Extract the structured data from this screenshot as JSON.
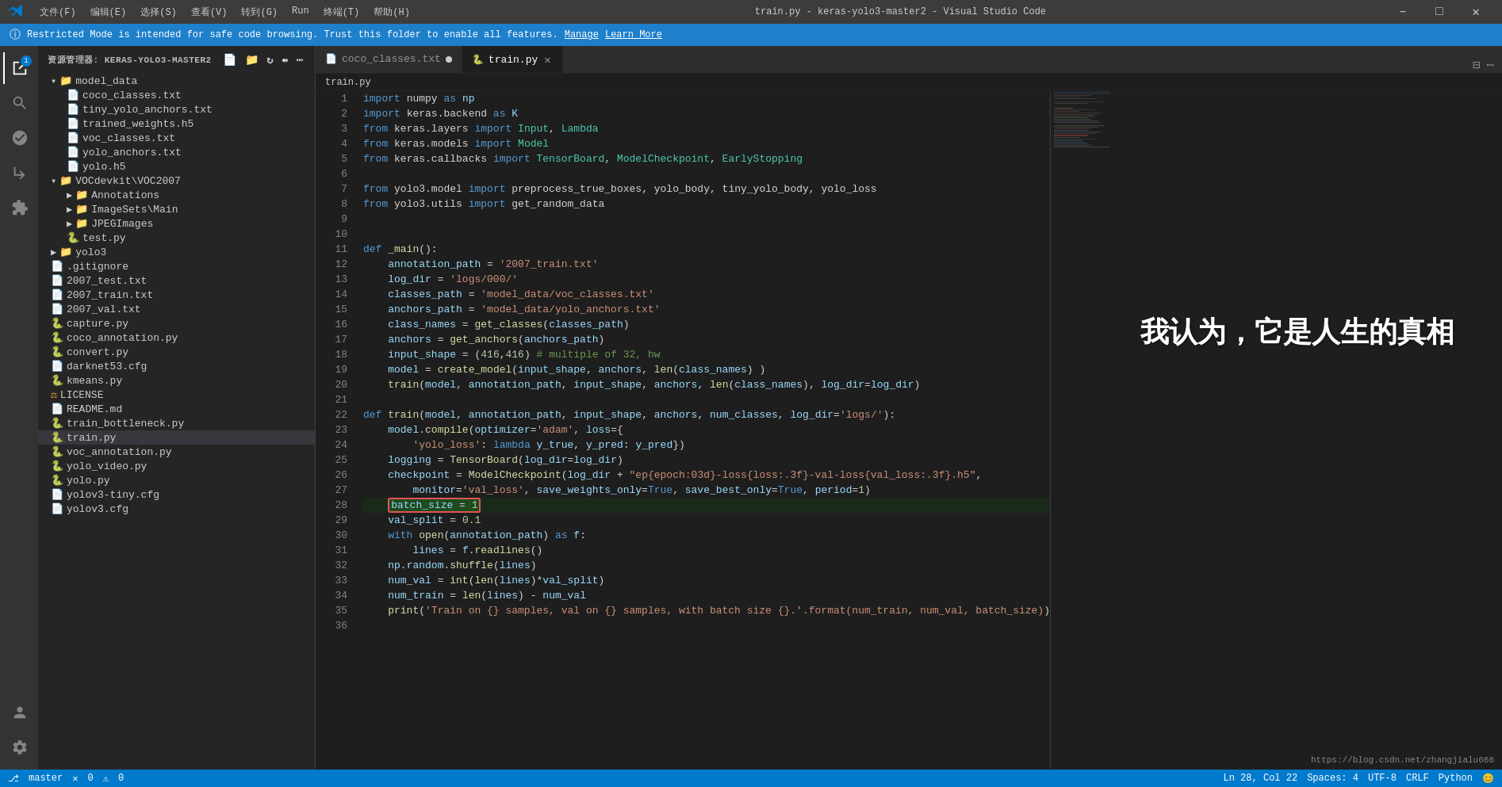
{
  "titlebar": {
    "menus": [
      "文件(F)",
      "编辑(E)",
      "选择(S)",
      "查看(V)",
      "转到(G)",
      "Run",
      "终端(T)",
      "帮助(H)"
    ],
    "title": "train.py - keras-yolo3-master2 - Visual Studio Code",
    "vscode_icon": "VS"
  },
  "notification": {
    "text": "Restricted Mode is intended for safe code browsing. Trust this folder to enable all features.",
    "manage": "Manage",
    "learn_more": "Learn More"
  },
  "sidebar": {
    "title": "资源管理器: KERAS-YOLO3-MASTER2",
    "files": [
      {
        "name": "model_data",
        "type": "folder",
        "indent": 1,
        "expanded": true
      },
      {
        "name": "coco_classes.txt",
        "type": "file",
        "indent": 2
      },
      {
        "name": "tiny_yolo_anchors.txt",
        "type": "file",
        "indent": 2
      },
      {
        "name": "trained_weights.h5",
        "type": "file",
        "indent": 2
      },
      {
        "name": "voc_classes.txt",
        "type": "file",
        "indent": 2
      },
      {
        "name": "yolo_anchors.txt",
        "type": "file",
        "indent": 2
      },
      {
        "name": "yolo.h5",
        "type": "file",
        "indent": 2
      },
      {
        "name": "VOCdevkit\\VOC2007",
        "type": "folder",
        "indent": 1,
        "expanded": true
      },
      {
        "name": "Annotations",
        "type": "folder",
        "indent": 2
      },
      {
        "name": "ImageSets\\Main",
        "type": "folder",
        "indent": 2
      },
      {
        "name": "JPEGImages",
        "type": "folder",
        "indent": 2
      },
      {
        "name": "test.py",
        "type": "file-py",
        "indent": 2
      },
      {
        "name": "yolo3",
        "type": "folder",
        "indent": 1
      },
      {
        "name": ".gitignore",
        "type": "file",
        "indent": 1
      },
      {
        "name": "2007_test.txt",
        "type": "file",
        "indent": 1
      },
      {
        "name": "2007_train.txt",
        "type": "file",
        "indent": 1
      },
      {
        "name": "2007_val.txt",
        "type": "file",
        "indent": 1
      },
      {
        "name": "capture.py",
        "type": "file-py",
        "indent": 1
      },
      {
        "name": "coco_annotation.py",
        "type": "file-py",
        "indent": 1
      },
      {
        "name": "convert.py",
        "type": "file-py",
        "indent": 1
      },
      {
        "name": "darknet53.cfg",
        "type": "file",
        "indent": 1
      },
      {
        "name": "kmeans.py",
        "type": "file-py",
        "indent": 1
      },
      {
        "name": "LICENSE",
        "type": "file",
        "indent": 1
      },
      {
        "name": "README.md",
        "type": "file",
        "indent": 1
      },
      {
        "name": "train_bottleneck.py",
        "type": "file-py",
        "indent": 1
      },
      {
        "name": "train.py",
        "type": "file-py",
        "indent": 1,
        "active": true
      },
      {
        "name": "voc_annotation.py",
        "type": "file-py",
        "indent": 1
      },
      {
        "name": "yolo_video.py",
        "type": "file-py",
        "indent": 1
      },
      {
        "name": "yolo.py",
        "type": "file-py",
        "indent": 1
      },
      {
        "name": "yolov3-tiny.cfg",
        "type": "file",
        "indent": 1
      },
      {
        "name": "yolov3.cfg",
        "type": "file",
        "indent": 1
      }
    ]
  },
  "tabs": [
    {
      "label": "coco_classes.txt",
      "modified": true,
      "active": false
    },
    {
      "label": "train.py",
      "modified": false,
      "active": true
    }
  ],
  "breadcrumb": "train.py",
  "editor": {
    "filename": "train.py",
    "lines": [
      {
        "n": 1,
        "code": "import numpy as np"
      },
      {
        "n": 2,
        "code": "import keras.backend as K"
      },
      {
        "n": 3,
        "code": "from keras.layers import Input, Lambda"
      },
      {
        "n": 4,
        "code": "from keras.models import Model"
      },
      {
        "n": 5,
        "code": "from keras.callbacks import TensorBoard, ModelCheckpoint, EarlyStopping"
      },
      {
        "n": 6,
        "code": ""
      },
      {
        "n": 7,
        "code": "from yolo3.model import preprocess_true_boxes, yolo_body, tiny_yolo_body, yolo_loss"
      },
      {
        "n": 8,
        "code": "from yolo3.utils import get_random_data"
      },
      {
        "n": 9,
        "code": ""
      },
      {
        "n": 10,
        "code": ""
      },
      {
        "n": 11,
        "code": "def _main():"
      },
      {
        "n": 12,
        "code": "    annotation_path = '2007_train.txt'"
      },
      {
        "n": 13,
        "code": "    log_dir = 'logs/000/'"
      },
      {
        "n": 14,
        "code": "    classes_path = 'model_data/voc_classes.txt'"
      },
      {
        "n": 15,
        "code": "    anchors_path = 'model_data/yolo_anchors.txt'"
      },
      {
        "n": 16,
        "code": "    class_names = get_classes(classes_path)"
      },
      {
        "n": 17,
        "code": "    anchors = get_anchors(anchors_path)"
      },
      {
        "n": 18,
        "code": "    input_shape = (416,416) # multiple of 32, hw"
      },
      {
        "n": 19,
        "code": "    model = create_model(input_shape, anchors, len(class_names) )"
      },
      {
        "n": 20,
        "code": "    train(model, annotation_path, input_shape, anchors, len(class_names), log_dir=log_dir)"
      },
      {
        "n": 21,
        "code": ""
      },
      {
        "n": 22,
        "code": "def train(model, annotation_path, input_shape, anchors, num_classes, log_dir='logs/'):"
      },
      {
        "n": 23,
        "code": "    model.compile(optimizer='adam', loss={"
      },
      {
        "n": 24,
        "code": "        'yolo_loss': lambda y_true, y_pred: y_pred})"
      },
      {
        "n": 25,
        "code": "    logging = TensorBoard(log_dir=log_dir)"
      },
      {
        "n": 26,
        "code": "    checkpoint = ModelCheckpoint(log_dir + \"ep{epoch:03d}-loss{loss:.3f}-val-loss{val_loss:.3f}.h5\","
      },
      {
        "n": 27,
        "code": "        monitor='val_loss', save_weights_only=True, save_best_only=True, period=1)"
      },
      {
        "n": 28,
        "code": "    batch_size = 1",
        "highlight": true
      },
      {
        "n": 29,
        "code": "    val_split = 0.1"
      },
      {
        "n": 30,
        "code": "    with open(annotation_path) as f:"
      },
      {
        "n": 31,
        "code": "        lines = f.readlines()"
      },
      {
        "n": 32,
        "code": "    np.random.shuffle(lines)"
      },
      {
        "n": 33,
        "code": "    num_val = int(len(lines)*val_split)"
      },
      {
        "n": 34,
        "code": "    num_train = len(lines) - num_val"
      },
      {
        "n": 35,
        "code": "    print('Train on {} samples, val on {} samples, with batch size {}.'.format(num_train, num_val, batch_size))"
      },
      {
        "n": 36,
        "code": ""
      }
    ]
  },
  "overlay_text": "我认为，它是人生的真相",
  "status_bar": {
    "branch": "master",
    "errors": "0",
    "warnings": "0",
    "line": "Ln 28, Col 22",
    "spaces": "Spaces: 4",
    "encoding": "UTF-8",
    "crlf": "CRLF",
    "lang": "Python",
    "feedback": "😊"
  },
  "csdn_watermark": "https://blog.csdn.net/zhangjialu666",
  "colors": {
    "accent": "#007acc",
    "titlebar_bg": "#3c3c3c",
    "sidebar_bg": "#252526",
    "editor_bg": "#1e1e1e",
    "tab_active_bg": "#1e1e1e",
    "notification_bg": "#1e7fcb",
    "highlight_line": "#2a3a4a",
    "batch_size_border": "#e05555"
  }
}
